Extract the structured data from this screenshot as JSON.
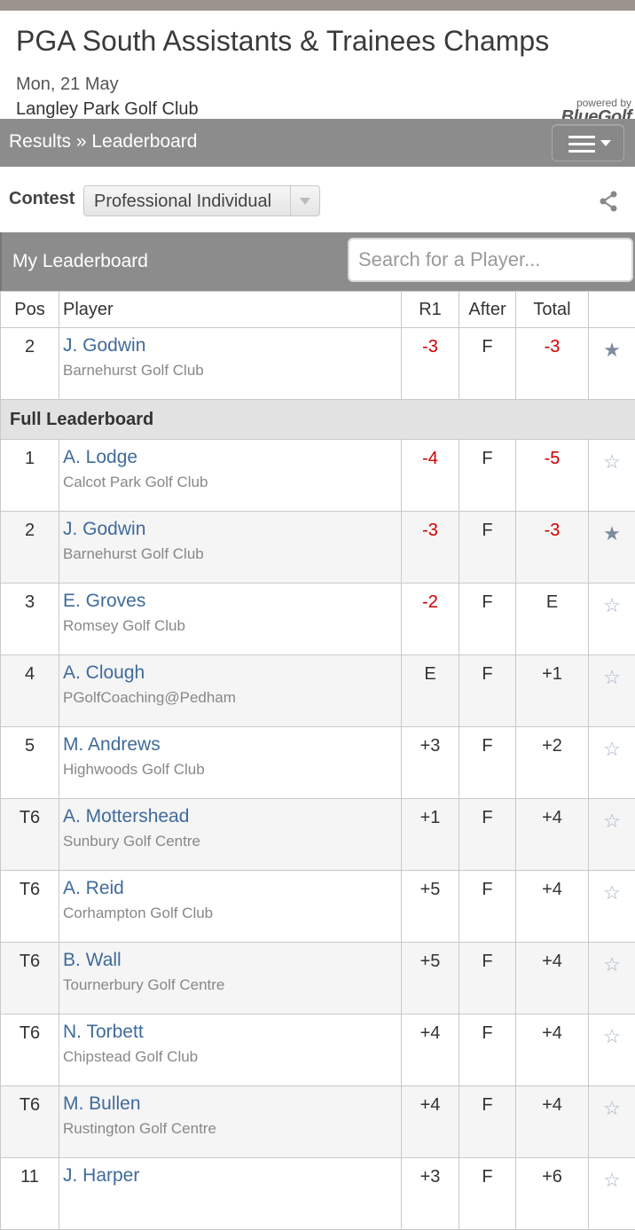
{
  "event": {
    "title": "PGA South Assistants & Trainees Champs",
    "date": "Mon, 21 May",
    "venue": "Langley Park Golf Club",
    "powered_by": "powered by",
    "brand": "BlueGolf"
  },
  "nav": {
    "breadcrumb": "Results » Leaderboard",
    "menu_icon": "hamburger-icon"
  },
  "contest": {
    "label": "Contest",
    "selected": "Professional Individual",
    "share_icon": "share-icon"
  },
  "my_leaderboard": {
    "title": "My Leaderboard",
    "search_placeholder": "Search for a Player..."
  },
  "columns": {
    "pos": "Pos",
    "player": "Player",
    "r1": "R1",
    "after": "After",
    "total": "Total"
  },
  "my_rows": [
    {
      "pos": "2",
      "name": "J. Godwin",
      "club": "Barnehurst Golf Club",
      "r1": "-3",
      "after": "F",
      "total": "-3",
      "starred": true
    }
  ],
  "full_title": "Full Leaderboard",
  "rows": [
    {
      "pos": "1",
      "name": "A. Lodge",
      "club": "Calcot Park Golf Club",
      "r1": "-4",
      "after": "F",
      "total": "-5",
      "starred": false
    },
    {
      "pos": "2",
      "name": "J. Godwin",
      "club": "Barnehurst Golf Club",
      "r1": "-3",
      "after": "F",
      "total": "-3",
      "starred": true
    },
    {
      "pos": "3",
      "name": "E. Groves",
      "club": "Romsey Golf Club",
      "r1": "-2",
      "after": "F",
      "total": "E",
      "starred": false
    },
    {
      "pos": "4",
      "name": "A. Clough",
      "club": "PGolfCoaching@Pedham",
      "r1": "E",
      "after": "F",
      "total": "+1",
      "starred": false
    },
    {
      "pos": "5",
      "name": "M. Andrews",
      "club": "Highwoods Golf Club",
      "r1": "+3",
      "after": "F",
      "total": "+2",
      "starred": false
    },
    {
      "pos": "T6",
      "name": "A. Mottershead",
      "club": "Sunbury Golf Centre",
      "r1": "+1",
      "after": "F",
      "total": "+4",
      "starred": false
    },
    {
      "pos": "T6",
      "name": "A. Reid",
      "club": "Corhampton Golf Club",
      "r1": "+5",
      "after": "F",
      "total": "+4",
      "starred": false
    },
    {
      "pos": "T6",
      "name": "B. Wall",
      "club": "Tournerbury Golf Centre",
      "r1": "+5",
      "after": "F",
      "total": "+4",
      "starred": false
    },
    {
      "pos": "T6",
      "name": "N. Torbett",
      "club": "Chipstead Golf Club",
      "r1": "+4",
      "after": "F",
      "total": "+4",
      "starred": false
    },
    {
      "pos": "T6",
      "name": "M. Bullen",
      "club": "Rustington Golf Centre",
      "r1": "+4",
      "after": "F",
      "total": "+4",
      "starred": false
    },
    {
      "pos": "11",
      "name": "J. Harper",
      "club": "",
      "r1": "+3",
      "after": "F",
      "total": "+6",
      "starred": false
    }
  ],
  "colors": {
    "negative": "#c00000",
    "link": "#3f6b9a",
    "bar": "#8c8c8c"
  }
}
